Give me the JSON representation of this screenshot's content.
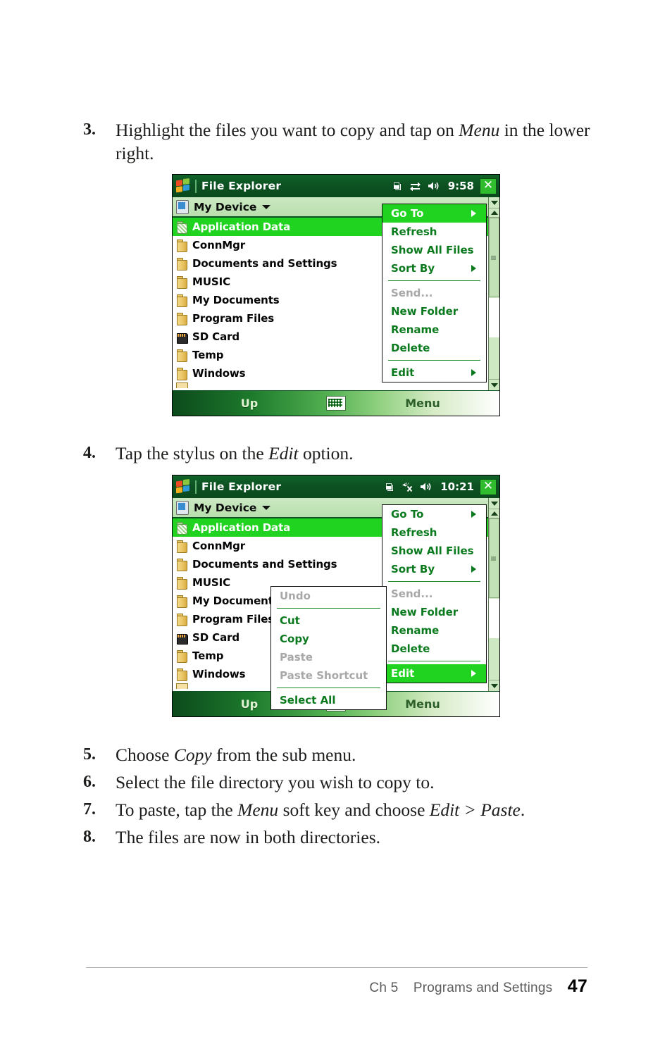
{
  "page": {
    "footer": {
      "chapter": "Ch 5",
      "section": "Programs and Settings",
      "page_number": "47"
    }
  },
  "steps": [
    {
      "number": "3.",
      "parts": [
        {
          "t": "Highlight the files you want to copy and tap on ",
          "i": false
        },
        {
          "t": "Menu",
          "i": true
        },
        {
          "t": " in the lower right.",
          "i": false
        }
      ],
      "plain": "Highlight the files you want to copy and tap on Menu in the lower right."
    },
    {
      "number": "4.",
      "parts": [
        {
          "t": "Tap the stylus on the ",
          "i": false
        },
        {
          "t": "Edit",
          "i": true
        },
        {
          "t": " option.",
          "i": false
        }
      ],
      "plain": "Tap the stylus on the Edit option."
    },
    {
      "number": "5.",
      "parts": [
        {
          "t": "Choose ",
          "i": false
        },
        {
          "t": "Copy",
          "i": true
        },
        {
          "t": " from the sub menu.",
          "i": false
        }
      ],
      "plain": "Choose Copy from the sub menu."
    },
    {
      "number": "6.",
      "parts": [
        {
          "t": "Select the file directory you wish to copy to.",
          "i": false
        }
      ],
      "plain": "Select the file directory you wish to copy to."
    },
    {
      "number": "7.",
      "parts": [
        {
          "t": "To paste, tap the ",
          "i": false
        },
        {
          "t": "Menu",
          "i": true
        },
        {
          "t": " soft key and choose ",
          "i": false
        },
        {
          "t": "Edit > Paste",
          "i": true
        },
        {
          "t": ".",
          "i": false
        }
      ],
      "plain": "To paste, tap the Menu soft key and choose Edit > Paste."
    },
    {
      "number": "8.",
      "parts": [
        {
          "t": "The files are now in both directories.",
          "i": false
        }
      ],
      "plain": "The files are now in both directories."
    }
  ],
  "screenshot1": {
    "titlebar": {
      "app_title": "File Explorer",
      "time": "9:58",
      "icons": [
        "windows-start-icon",
        "copy-windows-icon",
        "connectivity-icon",
        "volume-speaker-icon"
      ],
      "close_label": "✕"
    },
    "devicebar": {
      "label": "My Device",
      "icon": "device-icon",
      "chevron": "chevron-down-icon"
    },
    "files": [
      {
        "name": "Application Data",
        "icon": "dotted-folder-icon",
        "selected": true
      },
      {
        "name": "ConnMgr",
        "icon": "folder-icon",
        "selected": false
      },
      {
        "name": "Documents and Settings",
        "icon": "folder-icon",
        "selected": false
      },
      {
        "name": "MUSIC",
        "icon": "folder-icon",
        "selected": false
      },
      {
        "name": "My Documents",
        "icon": "folder-icon",
        "selected": false
      },
      {
        "name": "Program Files",
        "icon": "folder-icon",
        "selected": false
      },
      {
        "name": "SD Card",
        "icon": "sd-card-icon",
        "selected": false
      },
      {
        "name": "Temp",
        "icon": "folder-icon",
        "selected": false
      },
      {
        "name": "Windows",
        "icon": "folder-icon",
        "selected": false
      }
    ],
    "menu": [
      {
        "label": "Go To",
        "submenu": true,
        "disabled": false,
        "highlight": true
      },
      {
        "label": "Refresh",
        "submenu": false,
        "disabled": false,
        "highlight": false
      },
      {
        "label": "Show All Files",
        "submenu": false,
        "disabled": false,
        "highlight": false
      },
      {
        "label": "Sort By",
        "submenu": true,
        "disabled": false,
        "highlight": false
      },
      {
        "separator": true
      },
      {
        "label": "Send...",
        "submenu": false,
        "disabled": true,
        "highlight": false
      },
      {
        "label": "New Folder",
        "submenu": false,
        "disabled": false,
        "highlight": false
      },
      {
        "label": "Rename",
        "submenu": false,
        "disabled": false,
        "highlight": false
      },
      {
        "label": "Delete",
        "submenu": false,
        "disabled": false,
        "highlight": false
      },
      {
        "separator": true
      },
      {
        "label": "Edit",
        "submenu": true,
        "disabled": false,
        "highlight": false
      }
    ],
    "softkeys": {
      "left": "Up",
      "center_icon": "keyboard-icon",
      "right": "Menu"
    }
  },
  "screenshot2": {
    "titlebar": {
      "app_title": "File Explorer",
      "time": "10:21",
      "icons": [
        "windows-start-icon",
        "copy-windows-icon",
        "no-connectivity-icon",
        "volume-speaker-icon"
      ],
      "close_label": "✕"
    },
    "devicebar": {
      "label": "My Device",
      "icon": "device-icon",
      "chevron": "chevron-down-icon"
    },
    "files": [
      {
        "name": "Application Data",
        "icon": "dotted-folder-icon",
        "selected": true
      },
      {
        "name": "ConnMgr",
        "icon": "folder-icon",
        "selected": false
      },
      {
        "name": "Documents and Settings",
        "icon": "folder-icon",
        "selected": false
      },
      {
        "name": "MUSIC",
        "icon": "folder-icon",
        "selected": false
      },
      {
        "name": "My Documents",
        "icon": "folder-icon",
        "selected": false
      },
      {
        "name": "Program Files",
        "icon": "folder-icon",
        "selected": false
      },
      {
        "name": "SD Card",
        "icon": "sd-card-icon",
        "selected": false
      },
      {
        "name": "Temp",
        "icon": "folder-icon",
        "selected": false
      },
      {
        "name": "Windows",
        "icon": "folder-icon",
        "selected": false
      }
    ],
    "menu": [
      {
        "label": "Go To",
        "submenu": true,
        "disabled": false,
        "highlight": false
      },
      {
        "label": "Refresh",
        "submenu": false,
        "disabled": false,
        "highlight": false
      },
      {
        "label": "Show All Files",
        "submenu": false,
        "disabled": false,
        "highlight": false
      },
      {
        "label": "Sort By",
        "submenu": true,
        "disabled": false,
        "highlight": false
      },
      {
        "separator": true
      },
      {
        "label": "Send...",
        "submenu": false,
        "disabled": true,
        "highlight": false
      },
      {
        "label": "New Folder",
        "submenu": false,
        "disabled": false,
        "highlight": false
      },
      {
        "label": "Rename",
        "submenu": false,
        "disabled": false,
        "highlight": false
      },
      {
        "label": "Delete",
        "submenu": false,
        "disabled": false,
        "highlight": false
      },
      {
        "separator": true
      },
      {
        "label": "Edit",
        "submenu": true,
        "disabled": false,
        "highlight": true
      }
    ],
    "edit_submenu": [
      {
        "label": "Undo",
        "disabled": true
      },
      {
        "separator": true
      },
      {
        "label": "Cut",
        "disabled": false
      },
      {
        "label": "Copy",
        "disabled": false
      },
      {
        "label": "Paste",
        "disabled": true
      },
      {
        "label": "Paste Shortcut",
        "disabled": true
      },
      {
        "separator": true
      },
      {
        "label": "Select All",
        "disabled": false
      }
    ],
    "softkeys": {
      "left": "Up",
      "center_icon": "keyboard-icon",
      "right": "Menu"
    }
  },
  "colors": {
    "titlebar_dark_green": "#0d5222",
    "highlight_green": "#21d321",
    "menu_text_green": "#0b7a1e",
    "disabled_gray": "#a8a8a8",
    "devicebar_green": "#c2e4b7",
    "scrollbar_track": "#cfe8c4"
  }
}
